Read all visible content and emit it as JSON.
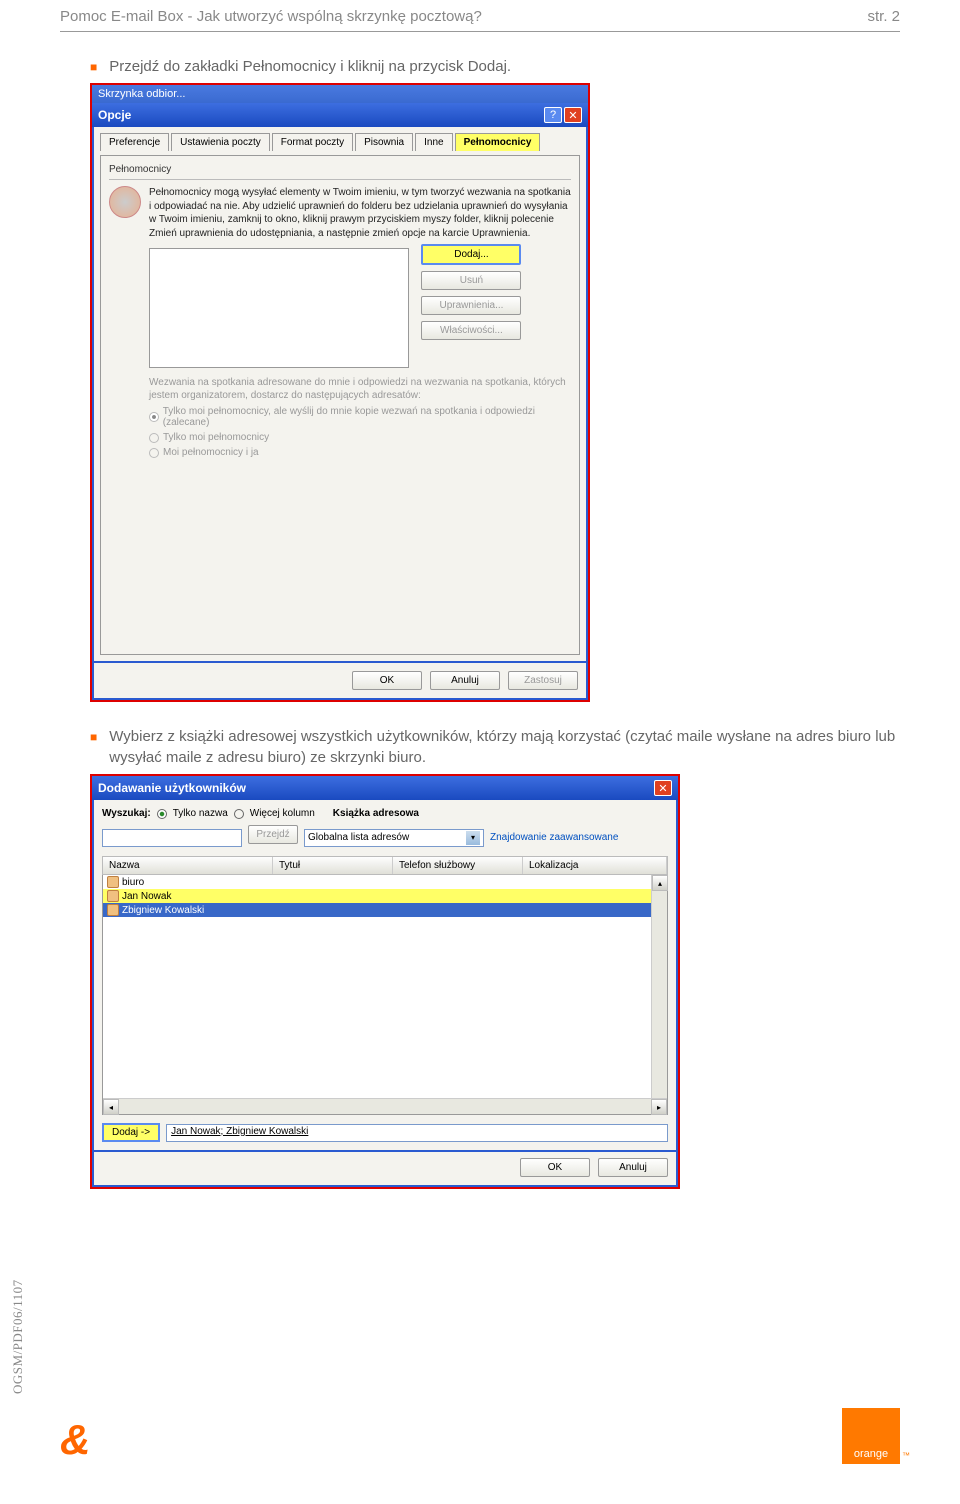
{
  "header": {
    "title": "Pomoc E-mail Box - Jak utworzyć wspólną skrzynkę pocztową?",
    "page": "str. 2"
  },
  "step1": {
    "text": "Przejdź do zakładki Pełnomocnicy i kliknij na przycisk Dodaj."
  },
  "dlg1": {
    "top_cut": "Skrzynka odbior...",
    "title": "Opcje",
    "tabs": [
      "Preferencje",
      "Ustawienia poczty",
      "Format poczty",
      "Pisownia",
      "Inne",
      "Pełnomocnicy"
    ],
    "fieldset": "Pełnomocnicy",
    "desc": "Pełnomocnicy mogą wysyłać elementy w Twoim imieniu, w tym tworzyć wezwania na spotkania i odpowiadać na nie. Aby udzielić uprawnień do folderu bez udzielania uprawnień do wysyłania w Twoim imieniu, zamknij to okno, kliknij prawym przyciskiem myszy folder, kliknij polecenie Zmień uprawnienia do udostępniania, a następnie zmień opcje na karcie Uprawnienia.",
    "btn_add": "Dodaj...",
    "btn_remove": "Usuń",
    "btn_perm": "Uprawnienia...",
    "btn_prop": "Właściwości...",
    "gray": "Wezwania na spotkania adresowane do mnie i odpowiedzi na wezwania na spotkania, których jestem organizatorem, dostarcz do następujących adresatów:",
    "r1": "Tylko moi pełnomocnicy, ale wyślij do mnie kopie wezwań na spotkania i odpowiedzi (zalecane)",
    "r2": "Tylko moi pełnomocnicy",
    "r3": "Moi pełnomocnicy i ja",
    "ok": "OK",
    "cancel": "Anuluj",
    "apply": "Zastosuj"
  },
  "step2": {
    "text": "Wybierz z książki adresowej wszystkich użytkowników, którzy mają korzystać (czytać maile wysłane na adres biuro lub wysyłać maile z adresu biuro) ze skrzynki biuro."
  },
  "dlg2": {
    "title": "Dodawanie użytkowników",
    "search_lbl": "Wyszukaj:",
    "r_name": "Tylko nazwa",
    "r_more": "Więcej kolumn",
    "book_lbl": "Książka adresowa",
    "go": "Przejdź",
    "combo": "Globalna lista adresów",
    "adv": "Znajdowanie zaawansowane",
    "cols": {
      "name": "Nazwa",
      "title": "Tytuł",
      "phone": "Telefon służbowy",
      "loc": "Lokalizacja"
    },
    "rows": [
      "biuro",
      "Jan Nowak",
      "Zbigniew Kowalski"
    ],
    "add": "Dodaj ->",
    "added": "Jan Nowak; Zbigniew Kowalski",
    "ok": "OK",
    "cancel": "Anuluj"
  },
  "sidecode": "OGSM/PDF06/1107",
  "brand": "orange"
}
